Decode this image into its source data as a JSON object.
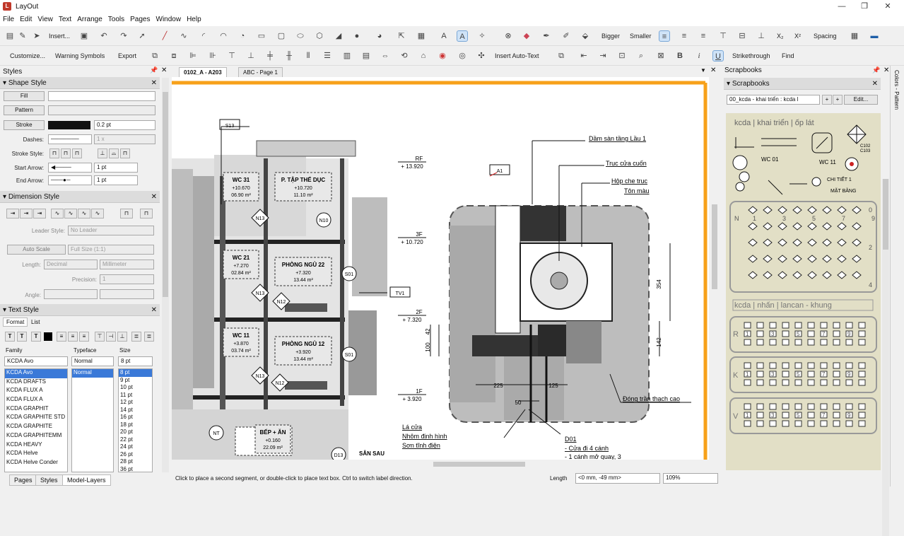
{
  "app": {
    "title": "LayOut",
    "logo": "L"
  },
  "menu": [
    "File",
    "Edit",
    "View",
    "Text",
    "Arrange",
    "Tools",
    "Pages",
    "Window",
    "Help"
  ],
  "toolbar1": {
    "insert": "Insert...",
    "bigger": "Bigger",
    "smaller": "Smaller",
    "spacing": "Spacing",
    "sub": "X₂",
    "sup": "X²"
  },
  "toolbar2": {
    "customize": "Customize...",
    "warning": "Warning Symbols",
    "export": "Export",
    "insert_auto_text": "Insert Auto-Text",
    "bold": "B",
    "italic": "i",
    "underline": "U",
    "strike": "Strikethrough",
    "find": "Find"
  },
  "styles": {
    "title": "Styles",
    "shape_style": "Shape Style",
    "fill": "Fill",
    "pattern": "Pattern",
    "stroke": "Stroke",
    "stroke_val": "0.2 pt",
    "dashes_label": "Dashes:",
    "dashes_val": "1 x",
    "stroke_style_label": "Stroke Style:",
    "start_arrow_label": "Start Arrow:",
    "start_arrow_val": "1 pt",
    "end_arrow_label": "End Arrow:",
    "end_arrow_val": "1 pt"
  },
  "dimension": {
    "title": "Dimension Style",
    "leader_label": "Leader Style:",
    "leader_val": "No Leader",
    "auto_scale": "Auto Scale",
    "full_size": "Full Size (1:1)",
    "length_label": "Length:",
    "decimal": "Decimal",
    "millimeter": "Millimeter",
    "precision_label": "Precision:",
    "precision_val": "1",
    "angle_label": "Angle:"
  },
  "text_style": {
    "title": "Text Style",
    "tab_format": "Format",
    "tab_list": "List",
    "family_label": "Family",
    "typeface_label": "Typeface",
    "size_label": "Size",
    "family_val": "KCDA Avo",
    "typeface_val": "Normal",
    "size_val": "8 pt",
    "families": [
      "KCDA Avo",
      "KCDA DRAFTS",
      "KCDA FLUX A",
      "KCDA FLUX A",
      "KCDA GRAPHIT",
      "KCDA GRAPHITE STD",
      "KCDA GRAPHITE",
      "KCDA GRAPHITEMM",
      "KCDA HEAVY",
      "KCDA Helve",
      "KCDA Helve Conder"
    ],
    "typefaces": [
      "Normal"
    ],
    "sizes": [
      "8 pt",
      "9 pt",
      "10 pt",
      "11 pt",
      "12 pt",
      "14 pt",
      "16 pt",
      "18 pt",
      "20 pt",
      "22 pt",
      "24 pt",
      "26 pt",
      "28 pt",
      "36 pt"
    ]
  },
  "doc_tabs": [
    "0102_A - A203",
    "ABC - Page 1"
  ],
  "drawing": {
    "levels": [
      {
        "name": "RF",
        "val": "+ 13.920"
      },
      {
        "name": "3F",
        "val": "+ 10.720"
      },
      {
        "name": "2F",
        "val": "+ 7.320"
      },
      {
        "name": "1F",
        "val": "+ 3.920"
      }
    ],
    "rooms": [
      {
        "name": "WC 31",
        "l1": "+10.670",
        "l2": "06.90 m²"
      },
      {
        "name": "P. TẬP THỂ DỤC",
        "l1": "+10.720",
        "l2": "11.10 m²"
      },
      {
        "name": "WC 21",
        "l1": "+7.270",
        "l2": "02.84 m²"
      },
      {
        "name": "PHÒNG NGỦ 22",
        "l1": "+7.320",
        "l2": "13.44 m²"
      },
      {
        "name": "WC 11",
        "l1": "+3.870",
        "l2": "03.74 m²"
      },
      {
        "name": "PHÒNG NGỦ 12",
        "l1": "+3.920",
        "l2": "13.44 m²"
      },
      {
        "name": "BẾP + ĂN",
        "l1": "+0.160",
        "l2": "22.09 m²"
      }
    ],
    "tags": [
      "S13",
      "N13",
      "N10",
      "N13",
      "N12",
      "N13",
      "N12",
      "S01",
      "S01",
      "NT",
      "D13",
      "A1",
      "TV1"
    ],
    "san_sau": "SÂN SAU",
    "annotations": [
      "Dầm sàn tầng Lầu 1",
      "Trục cửa cuốn",
      "Hộp che trục",
      "Tôn màu",
      "Đóng trần thạch cao",
      "Lá cửa",
      "Nhôm định hình",
      "Sơn tĩnh điện",
      "D01",
      "- Cửa đi 4 cánh",
      "- 1 cánh mở quay, 3"
    ],
    "dims": [
      "354",
      "42",
      "100",
      "142",
      "225",
      "125",
      "50"
    ]
  },
  "scrapbooks": {
    "title": "Scrapbooks",
    "sub": "Scrapbooks",
    "dropdown": "00_kcda - khai triển : kcda l",
    "edit": "Edit...",
    "header1": "kcda | khai triển | ốp lát",
    "header2": "kcda | nhấn | lancan - khung",
    "side_tab": "Colors - Pattern",
    "labels_wc": [
      "WC 01",
      "WC 11"
    ],
    "chitiet": "CHI TIẾT 1",
    "matbang": "MẶT BẰNG",
    "codes": [
      "C102",
      "C103"
    ],
    "row_letters": [
      "N",
      "R",
      "K",
      "V"
    ],
    "nums_odd": [
      "1",
      "3",
      "5",
      "7",
      "9"
    ],
    "nums_mid": [
      "0",
      "2",
      "4"
    ]
  },
  "bottom_tabs": [
    "Pages",
    "Styles",
    "Model-Layers"
  ],
  "status": {
    "hint": "Click to place a second segment, or double-click to place text box. Ctrl to switch label direction.",
    "length_label": "Length",
    "length_val": "<0 mm, -49 mm>",
    "zoom": "109%"
  }
}
